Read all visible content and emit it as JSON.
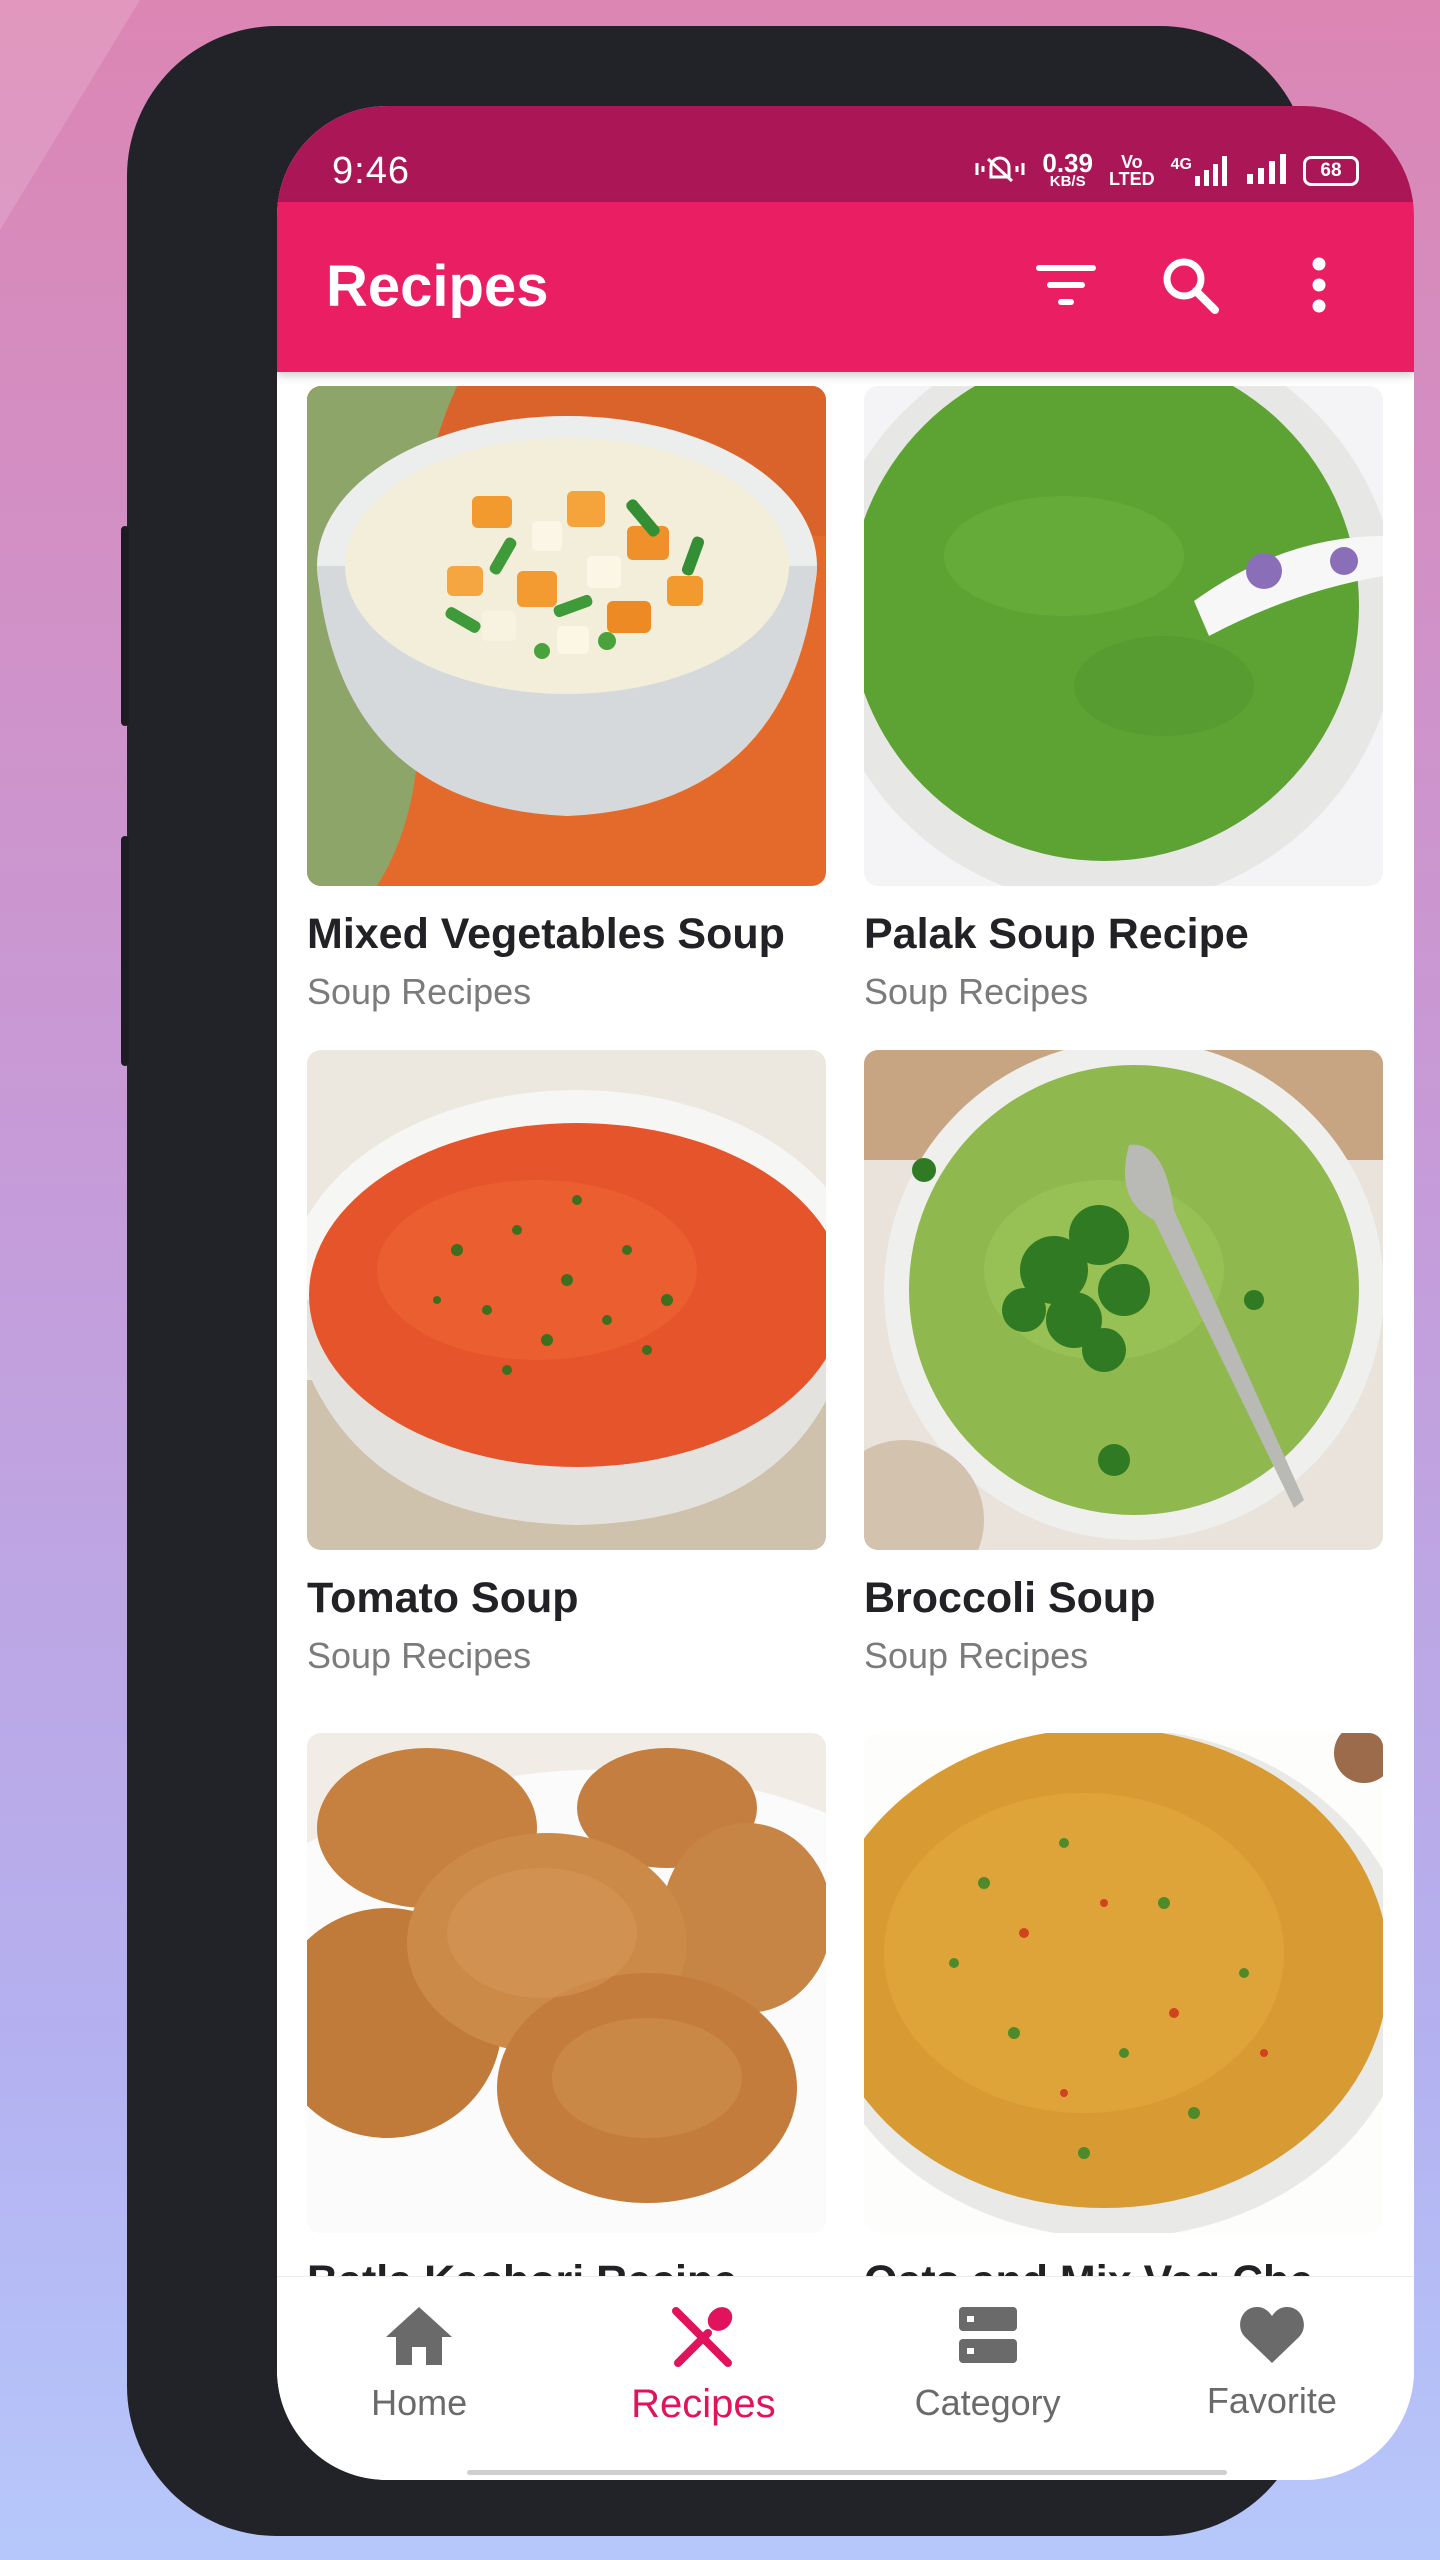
{
  "status_bar": {
    "time": "9:46",
    "net_speed_value": "0.39",
    "net_speed_unit": "KB/S",
    "volte_top": "Vo",
    "volte_bottom": "LTED",
    "network_type": "4G",
    "battery": "68"
  },
  "app_bar": {
    "title": "Recipes",
    "actions": [
      "filter-icon",
      "search-icon",
      "more-vert-icon"
    ]
  },
  "recipes": [
    {
      "title": "Mixed Vegetables Soup",
      "category": "Soup Recipes"
    },
    {
      "title": "Palak Soup Recipe",
      "category": "Soup Recipes"
    },
    {
      "title": "Tomato Soup",
      "category": "Soup Recipes"
    },
    {
      "title": "Broccoli Soup",
      "category": "Soup Recipes"
    },
    {
      "title": "Batla Kachori Recipe",
      "category": ""
    },
    {
      "title": "Oats and Mix Veg Che...",
      "category": ""
    }
  ],
  "bottom_nav": {
    "items": [
      {
        "label": "Home",
        "icon": "home-icon"
      },
      {
        "label": "Recipes",
        "icon": "fork-knife-icon"
      },
      {
        "label": "Category",
        "icon": "category-icon"
      },
      {
        "label": "Favorite",
        "icon": "heart-icon"
      }
    ],
    "active": "Recipes"
  },
  "colors": {
    "status_bar": "#ab1756",
    "app_bar": "#e91e63",
    "accent": "#e0135c",
    "inactive_nav": "#6a6a6a",
    "subtitle": "#7b7b7b"
  }
}
